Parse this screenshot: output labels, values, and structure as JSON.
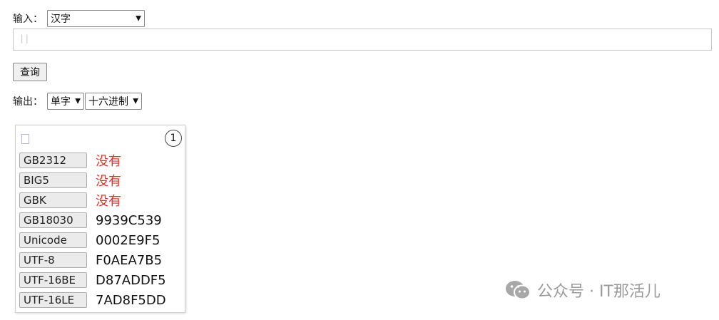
{
  "input": {
    "label": "输入：",
    "type_selected": "汉字",
    "value": "||"
  },
  "query_button": "查询",
  "output": {
    "label": "输出：",
    "mode_selected": "单字",
    "base_selected": "十六进制"
  },
  "result": {
    "count": "1",
    "encodings": [
      {
        "name": "GB2312",
        "value": "没有",
        "missing": true
      },
      {
        "name": "BIG5",
        "value": "没有",
        "missing": true
      },
      {
        "name": "GBK",
        "value": "没有",
        "missing": true
      },
      {
        "name": "GB18030",
        "value": "9939C539",
        "missing": false
      },
      {
        "name": "Unicode",
        "value": "0002E9F5",
        "missing": false
      },
      {
        "name": "UTF-8",
        "value": "F0AEA7B5",
        "missing": false
      },
      {
        "name": "UTF-16BE",
        "value": "D87ADDF5",
        "missing": false
      },
      {
        "name": "UTF-16LE",
        "value": "7AD8F5DD",
        "missing": false
      }
    ]
  },
  "watermark": {
    "icon": "wechat-icon",
    "text": "公众号 · IT那活儿"
  },
  "colors": {
    "missing": "#e0342a",
    "watermark": "#9a9a9a"
  }
}
